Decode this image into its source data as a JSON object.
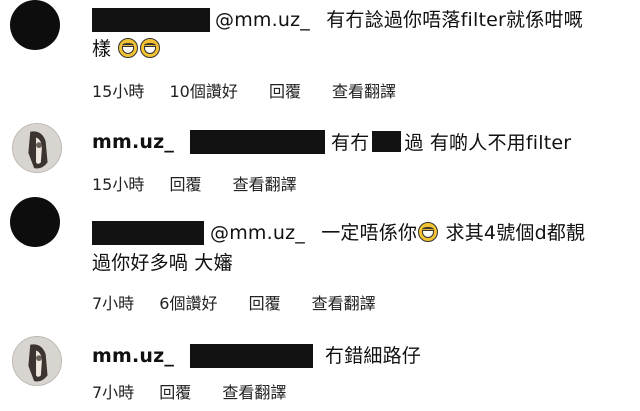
{
  "comments": [
    {
      "avatar": "black-circle",
      "username": "",
      "mention": "@mm.uz_",
      "text_line1": "有冇諗過你唔落filter就係咁嘅",
      "text_line2": "樣",
      "emoji": "joy-emoji",
      "time": "15小時",
      "likes": "10個讚好",
      "reply": "回覆",
      "translate": "查看翻譯"
    },
    {
      "avatar": "photo",
      "username": "mm.uz_",
      "text_part1": "有冇",
      "text_part2": "過 有啲人不用filter",
      "time": "15小時",
      "reply": "回覆",
      "translate": "查看翻譯"
    },
    {
      "avatar": "black-circle",
      "username": "",
      "mention": "@mm.uz_",
      "text_part1": "一定唔係你",
      "text_part2": "求其4號個d都靚",
      "text_line2": "過你好多喎 大嬸",
      "emoji": "joy-emoji",
      "time": "7小時",
      "likes": "6個讚好",
      "reply": "回覆",
      "translate": "查看翻譯"
    },
    {
      "avatar": "photo",
      "username": "mm.uz_",
      "text": "冇錯細路仔",
      "time": "7小時",
      "reply": "回覆",
      "translate": "查看翻譯"
    }
  ],
  "colors": {
    "redaction": "#121212",
    "emoji": "#f2c233"
  }
}
